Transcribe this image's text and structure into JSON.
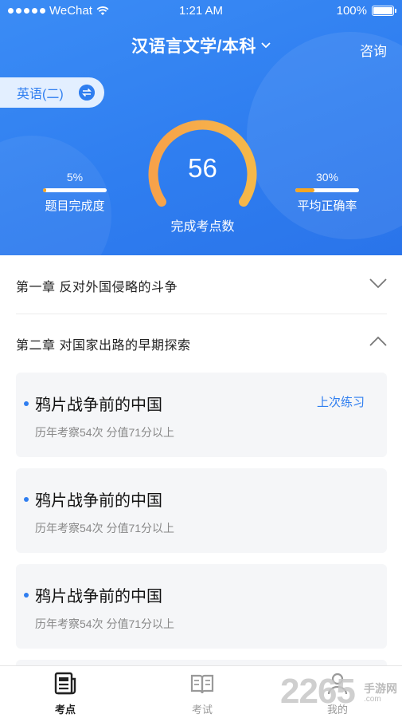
{
  "status_bar": {
    "carrier": "WeChat",
    "time": "1:21 AM",
    "battery": "100%"
  },
  "header": {
    "title": "汉语言文学/本科",
    "consult_label": "咨询",
    "subject_label": "英语(二)"
  },
  "progress": {
    "completed_points": "56",
    "completed_points_label": "完成考点数",
    "question_completion": {
      "percent_text": "5%",
      "value": 0.05,
      "label": "题目完成度"
    },
    "avg_accuracy": {
      "percent_text": "30%",
      "value": 0.3,
      "label": "平均正确率"
    }
  },
  "chapters": [
    {
      "title": "第一章  反对外国侵略的斗争",
      "expanded": false
    },
    {
      "title": "第二章  对国家出路的早期探索",
      "expanded": true
    }
  ],
  "topics": [
    {
      "title": "鸦片战争前的中国",
      "meta": "历年考察54次 分值71分以上",
      "last_practice": "上次练习"
    },
    {
      "title": "鸦片战争前的中国",
      "meta": "历年考察54次 分值71分以上",
      "last_practice": ""
    },
    {
      "title": "鸦片战争前的中国",
      "meta": "历年考察54次 分值71分以上",
      "last_practice": ""
    }
  ],
  "tabbar": {
    "items": [
      {
        "label": "考点",
        "icon": "newspaper-icon",
        "active": true
      },
      {
        "label": "考试",
        "icon": "open-book-icon",
        "active": false
      },
      {
        "label": "我的",
        "icon": "user-icon",
        "active": false
      }
    ]
  },
  "watermark": {
    "number": "2265",
    "text": "手游网",
    "url": ".com"
  },
  "colors": {
    "primary": "#2f7ef0",
    "accent": "#f5a623",
    "background": "#ffffff"
  }
}
